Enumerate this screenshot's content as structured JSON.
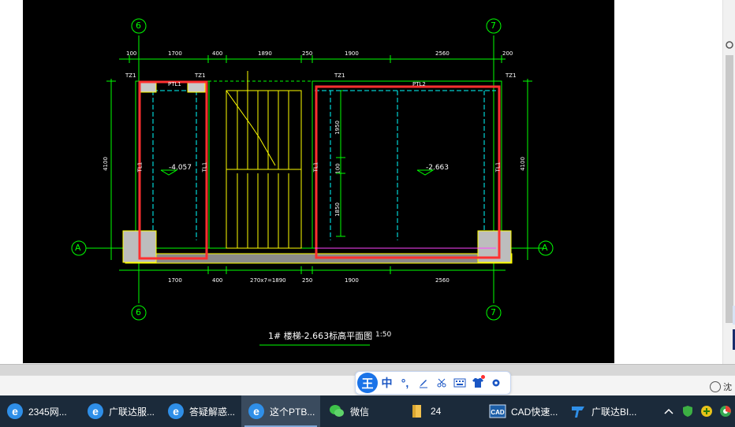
{
  "drawing": {
    "axis_top_left": "6",
    "axis_top_right": "7",
    "axis_bottom_left": "6",
    "axis_bottom_right": "7",
    "axis_left": "A",
    "axis_right": "A",
    "top_dims": [
      "100",
      "1700",
      "400",
      "1890",
      "250",
      "1900",
      "2560",
      "200"
    ],
    "bottom_dims": [
      "1700",
      "400",
      "270x7=1890",
      "250",
      "1900",
      "2560"
    ],
    "height_left": "4100",
    "height_right": "4100",
    "vert_dims": [
      "1950",
      "100",
      "1850"
    ],
    "tz_labels": [
      "TZ1",
      "TZ1",
      "TZ1",
      "TZ1"
    ],
    "ptl1": "PTL1",
    "ptl2": "PTL2",
    "tl_left_a": "TL1",
    "tl_left_b": "TL1",
    "tl_right_a": "TL1",
    "tl_right_b": "TL1",
    "elev_left": "-4.057",
    "elev_right": "-2.663",
    "title": "1# 楼梯-2.663标高平面图",
    "scale": "1:50"
  },
  "ime": {
    "logo": "王",
    "mode": "中",
    "punct": "°,",
    "items": [
      "pen-icon",
      "scissors-icon",
      "keyboard-icon",
      "shirt-icon",
      "gear-icon"
    ]
  },
  "statusbar": {
    "zoom_label": "沈"
  },
  "taskbar": {
    "items": [
      {
        "label": "2345网...",
        "icon": "ie-icon",
        "active": false
      },
      {
        "label": "广联达服...",
        "icon": "ie-icon",
        "active": false
      },
      {
        "label": "答疑解惑...",
        "icon": "ie-icon",
        "active": false
      },
      {
        "label": "这个PTB...",
        "icon": "ie-icon",
        "active": true
      },
      {
        "label": "微信",
        "icon": "wechat-icon",
        "active": false
      },
      {
        "label": "24",
        "icon": "folder-icon",
        "active": false
      },
      {
        "label": "CAD快速...",
        "icon": "cad-icon",
        "active": false
      },
      {
        "label": "广联达BI...",
        "icon": "glodon-icon",
        "active": false
      }
    ]
  },
  "colors": {
    "cad_bg": "#000000",
    "line_green": "#00ff00",
    "line_yellow": "#ffff00",
    "line_cyan": "#00ffff",
    "highlight_red": "#ff3030",
    "taskbar_bg": "#1b2a3a"
  }
}
